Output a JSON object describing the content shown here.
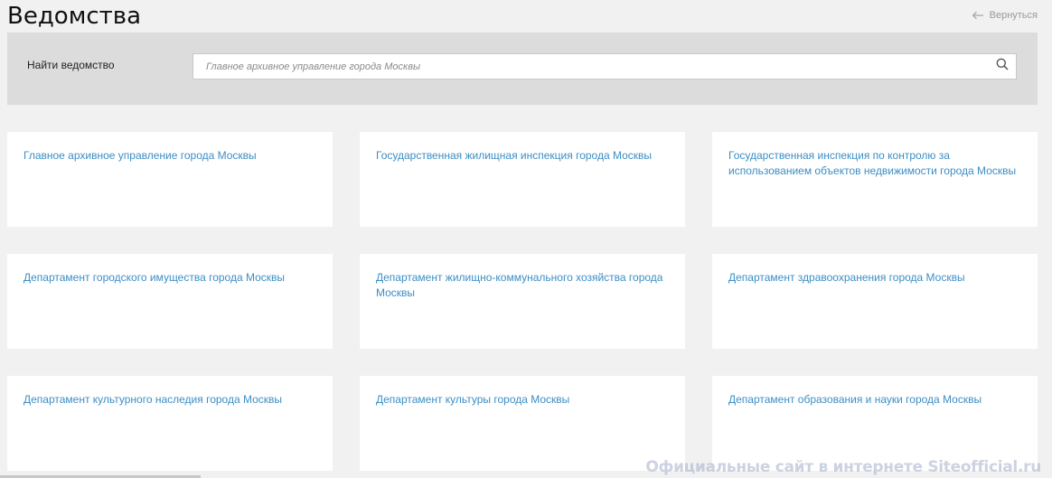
{
  "header": {
    "title": "Ведомства",
    "back_label": "Вернуться"
  },
  "search": {
    "label": "Найти ведомство",
    "placeholder": "Главное архивное управление города Москвы",
    "icon": "search-icon"
  },
  "departments": [
    {
      "name": "Главное архивное управление города Москвы"
    },
    {
      "name": "Государственная жилищная инспекция города Москвы"
    },
    {
      "name": "Государственная инспекция по контролю за использованием объектов недвижимости города Москвы"
    },
    {
      "name": "Департамент городского имущества города Москвы"
    },
    {
      "name": "Департамент жилищно-коммунального хозяйства города Москвы"
    },
    {
      "name": "Департамент здравоохранения города Москвы"
    },
    {
      "name": "Департамент культурного наследия города Москвы"
    },
    {
      "name": "Департамент культуры города Москвы"
    },
    {
      "name": "Департамент образования и науки города Москвы"
    }
  ],
  "watermark": "Официальные сайт в интернете Siteofficial.ru",
  "colors": {
    "link": "#3d8ec4",
    "panel": "#dcdcdc",
    "background": "#f2f1f2"
  }
}
